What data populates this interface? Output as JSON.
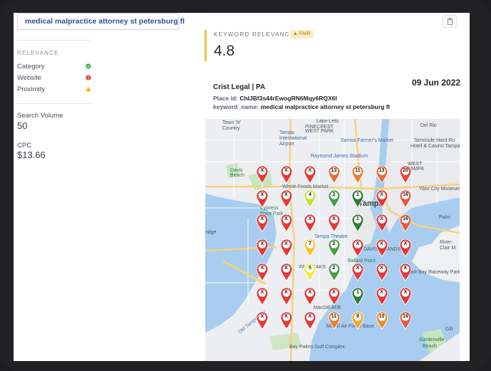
{
  "search": {
    "query": "medical malpractice attorney st petersburg fl"
  },
  "toolbar": {
    "delete_icon": "trash-icon"
  },
  "sidebar": {
    "relevance_title": "RELEVANCE",
    "relevance_items": [
      {
        "label": "Category",
        "status": "good",
        "icon": "check-circle-icon",
        "color": "#34a853"
      },
      {
        "label": "Website",
        "status": "bad",
        "icon": "alert-circle-icon",
        "color": "#e53935"
      },
      {
        "label": "Proximity",
        "status": "warning",
        "icon": "warning-triangle-icon",
        "color": "#f4b400"
      }
    ],
    "search_volume_label": "Search Volume",
    "search_volume_value": "50",
    "cpc_label": "CPC",
    "cpc_value": "$13.66"
  },
  "keyword_relevance": {
    "label": "KEYWORD RELEVANCE",
    "badge": "FAIR",
    "badge_icon": "thumbs-icon",
    "score": "4.8",
    "accent_color": "#f2c24c"
  },
  "report": {
    "business_name": "Crist Legal | PA",
    "date": "09 Jun 2022",
    "place_id_label": "Place id:",
    "place_id_value": "ChIJBf3s44rEwogRN6Mqy6RQX6I",
    "keyword_name_label": "keyword_name:",
    "keyword_name_value": "medical malpractice attorney st petersburg fl"
  },
  "map": {
    "labels": [
      {
        "text": "Town 'N'",
        "cls": ""
      },
      {
        "text": "Country",
        "cls": ""
      },
      {
        "text": "PINECREST",
        "cls": ""
      },
      {
        "text": "WEST PARK",
        "cls": ""
      },
      {
        "text": "Lake-Leto",
        "cls": ""
      },
      {
        "text": "Del Rio",
        "cls": ""
      },
      {
        "text": "Tampa",
        "cls": "blue"
      },
      {
        "text": "International",
        "cls": "blue"
      },
      {
        "text": "Airport",
        "cls": "blue"
      },
      {
        "text": "Sanwa Farmer's Market",
        "cls": "blue"
      },
      {
        "text": "Seminole Hard Ro",
        "cls": ""
      },
      {
        "text": "Hotel & Casino Tampa",
        "cls": ""
      },
      {
        "text": "Raymond James Stadium",
        "cls": "blue"
      },
      {
        "text": "WEST",
        "cls": ""
      },
      {
        "text": "TAMPA",
        "cls": ""
      },
      {
        "text": "Davis",
        "cls": "green"
      },
      {
        "text": "Beach",
        "cls": "green"
      },
      {
        "text": "Whole Foods Market",
        "cls": "blue"
      },
      {
        "text": "Tampa",
        "cls": "big"
      },
      {
        "text": "Ybor City Museum",
        "cls": ""
      },
      {
        "text": "Cypress",
        "cls": "green"
      },
      {
        "text": "Point Park",
        "cls": "green"
      },
      {
        "text": "Tampa Theatre",
        "cls": "blue"
      },
      {
        "text": "ridge",
        "cls": ""
      },
      {
        "text": "Palm",
        "cls": ""
      },
      {
        "text": "River-",
        "cls": ""
      },
      {
        "text": "Clair M",
        "cls": ""
      },
      {
        "text": "DAVIS ISLANDS",
        "cls": ""
      },
      {
        "text": "FAIR OAKS",
        "cls": ""
      },
      {
        "text": "Ballast Point",
        "cls": "green"
      },
      {
        "text": "East Bay Raceway Park",
        "cls": ""
      },
      {
        "text": "Old Tampa Bay",
        "cls": "light"
      },
      {
        "text": "MacDill AFB",
        "cls": ""
      },
      {
        "text": "McDill Air Force Base",
        "cls": ""
      },
      {
        "text": "Bay Palms Golf Complex",
        "cls": ""
      },
      {
        "text": "Gardenville",
        "cls": "green"
      },
      {
        "text": "Beach",
        "cls": "green"
      },
      {
        "text": "Gib",
        "cls": ""
      }
    ],
    "pins": [
      [
        "X",
        "X",
        "X",
        "13",
        "11",
        "13",
        "20"
      ],
      [
        "X",
        "X",
        "4",
        "2",
        "1",
        "X",
        "16"
      ],
      [
        "X",
        "X",
        "X",
        "X",
        "1",
        "X",
        "16"
      ],
      [
        "X",
        "X",
        "7",
        "2",
        "X",
        "X",
        "X"
      ],
      [
        "X",
        "X",
        "5",
        "2",
        "X",
        "X",
        "X"
      ],
      [
        "X",
        "X",
        "X",
        "X",
        "1",
        "X",
        "X"
      ],
      [
        "X",
        "X",
        "X",
        "11",
        "9",
        "10",
        "16"
      ]
    ],
    "pin_colors": {
      "X": "#e53935",
      "1": "#2e7d32",
      "2": "#43a047",
      "4": "#c6e03a",
      "5": "#f0ee45",
      "7": "#f4c430",
      "9": "#f5a623",
      "10": "#f08c28",
      "11": "#ef7b30",
      "13": "#ea6b36",
      "16": "#e55a3c",
      "20": "#e04b3a"
    }
  }
}
